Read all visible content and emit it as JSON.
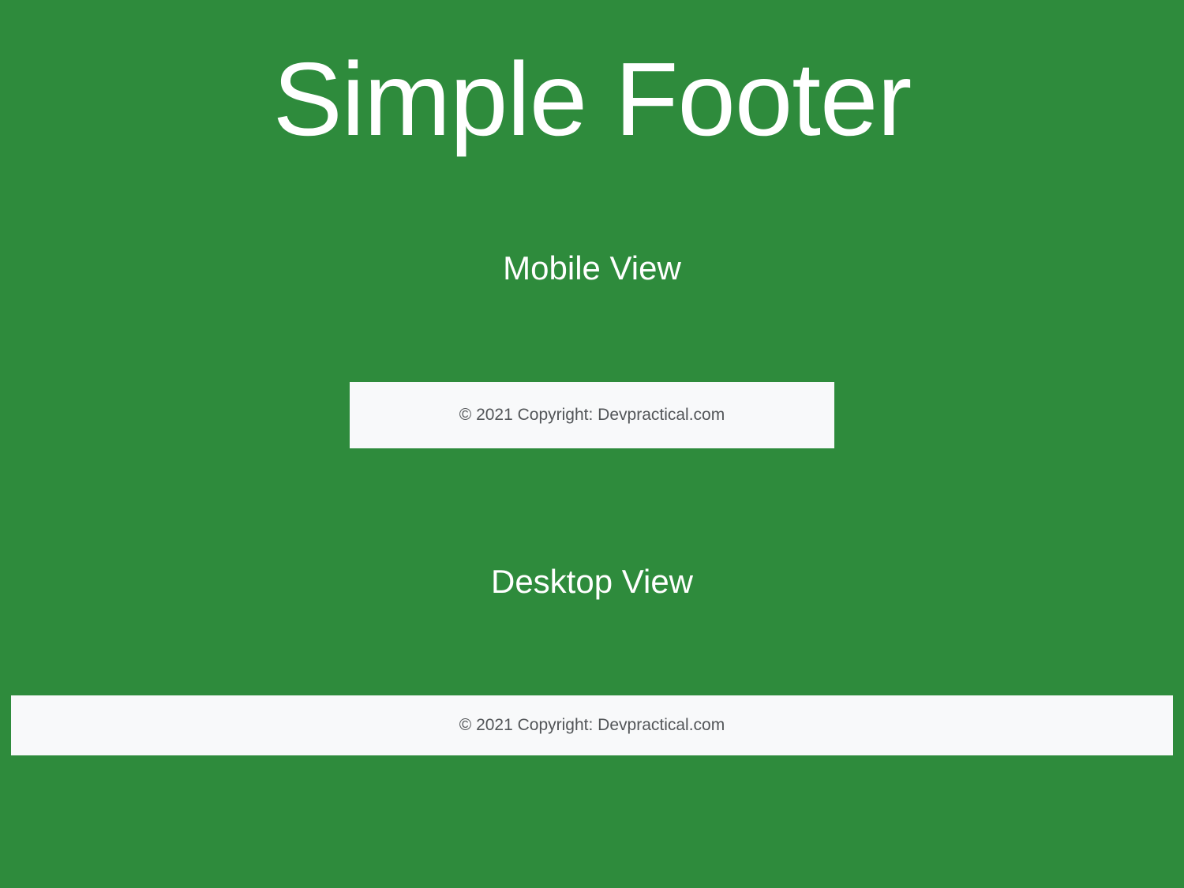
{
  "title": "Simple Footer",
  "sections": {
    "mobile": {
      "label": "Mobile View",
      "footer": {
        "copyright": "© 2021 Copyright: ",
        "site": "Devpractical.com"
      }
    },
    "desktop": {
      "label": "Desktop View",
      "footer": {
        "copyright": "© 2021 Copyright: ",
        "site": "Devpractical.com"
      }
    }
  }
}
